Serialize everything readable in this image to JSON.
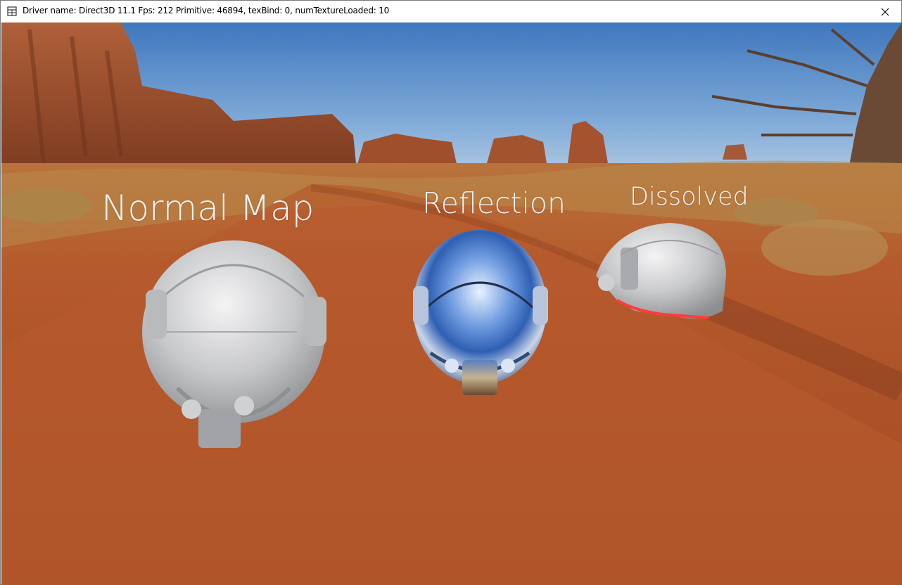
{
  "window": {
    "title": "Driver name: Direct3D 11.1 Fps: 212 Primitive: 46894, texBind: 0, numTextureLoaded: 10",
    "icon": "app-grid-icon",
    "close_icon": "close-icon"
  },
  "scene": {
    "labels": {
      "normal_map": "Normal Map",
      "reflection": "Reflection",
      "dissolved": "Dissolved"
    },
    "objects": [
      "helmet-normal-map",
      "helmet-reflection",
      "helmet-dissolved"
    ],
    "colors": {
      "sky": "#4f86c4",
      "ground": "#b5562a",
      "rock": "#a4512c",
      "metal": "#c9c9cb",
      "dissolve_edge": "#ff3b3b"
    }
  }
}
